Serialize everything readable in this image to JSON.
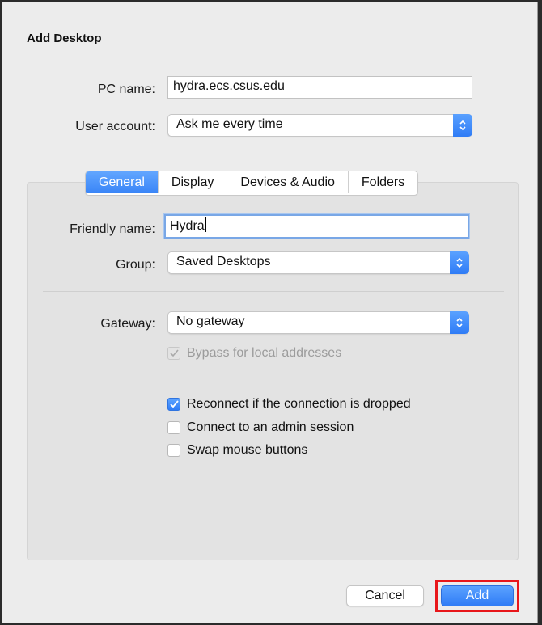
{
  "dialog": {
    "title": "Add Desktop"
  },
  "pc_name": {
    "label": "PC name:",
    "value": "hydra.ecs.csus.edu"
  },
  "user_account": {
    "label": "User account:",
    "value": "Ask me every time"
  },
  "tabs": [
    {
      "label": "General",
      "active": true
    },
    {
      "label": "Display",
      "active": false
    },
    {
      "label": "Devices & Audio",
      "active": false
    },
    {
      "label": "Folders",
      "active": false
    }
  ],
  "friendly_name": {
    "label": "Friendly name:",
    "value": "Hydra"
  },
  "group": {
    "label": "Group:",
    "value": "Saved Desktops"
  },
  "gateway": {
    "label": "Gateway:",
    "value": "No gateway"
  },
  "bypass": {
    "label": "Bypass for local addresses",
    "checked": true,
    "enabled": false
  },
  "options": [
    {
      "label": "Reconnect if the connection is dropped",
      "checked": true
    },
    {
      "label": "Connect to an admin session",
      "checked": false
    },
    {
      "label": "Swap mouse buttons",
      "checked": false
    }
  ],
  "buttons": {
    "cancel": "Cancel",
    "add": "Add"
  },
  "colors": {
    "accent": "#3a85f7",
    "highlight": "#e8161a"
  }
}
